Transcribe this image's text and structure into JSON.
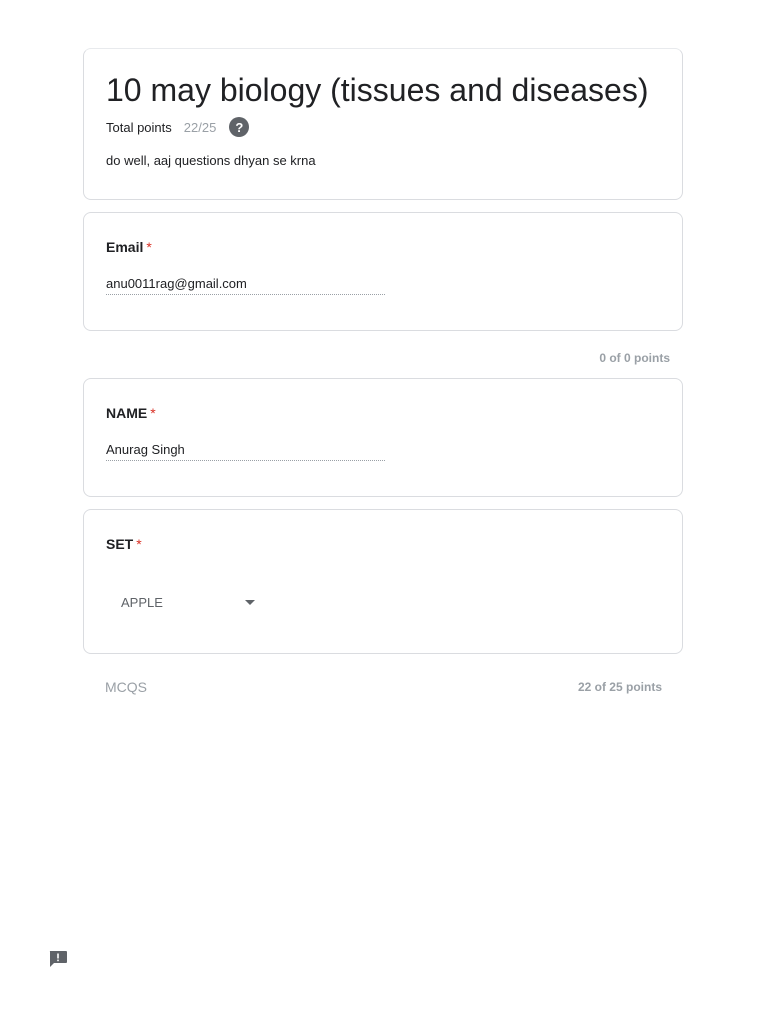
{
  "form": {
    "title": "10 may biology (tissues and diseases)",
    "total_points_label": "Total points",
    "total_points_value": "22/25",
    "help_icon": "help-icon",
    "description": "do well, aaj questions dhyan se krna"
  },
  "email": {
    "label": "Email",
    "required_mark": "*",
    "value": "anu0011rag@gmail.com",
    "points": "0 of 0 points"
  },
  "name_question": {
    "label": "NAME",
    "required_mark": "*",
    "value": "Anurag Singh"
  },
  "set_question": {
    "label": "SET",
    "required_mark": "*",
    "selected": "APPLE",
    "arrow_icon": "caret-down-icon"
  },
  "section": {
    "title": "MCQS",
    "points": "22 of 25 points"
  },
  "footer": {
    "feedback_icon": "feedback-icon"
  },
  "colors": {
    "required": "#d93025",
    "muted": "#9aa0a6",
    "border": "#dadce0",
    "icon": "#5f6368"
  }
}
